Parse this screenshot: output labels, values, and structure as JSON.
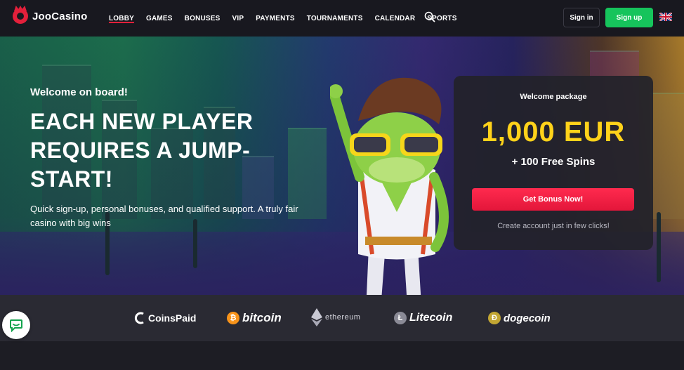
{
  "header": {
    "logo_text": "JooCasino",
    "nav": [
      {
        "label": "LOBBY",
        "active": true
      },
      {
        "label": "GAMES"
      },
      {
        "label": "BONUSES"
      },
      {
        "label": "VIP"
      },
      {
        "label": "PAYMENTS"
      },
      {
        "label": "TOURNAMENTS"
      },
      {
        "label": "CALENDAR"
      },
      {
        "label": "SPORTS"
      }
    ],
    "signin_label": "Sign in",
    "signup_label": "Sign up",
    "language_icon": "uk-flag-icon"
  },
  "hero": {
    "welcome": "Welcome on board!",
    "headline_line1": "EACH NEW PLAYER",
    "headline_line2": "REQUIRES A JUMP-",
    "headline_line3": "START!",
    "subtext": "Quick sign-up, personal bonuses, and qualified support. A truly fair casino with big wins"
  },
  "bonus": {
    "label": "Welcome package",
    "amount": "1,000 EUR",
    "spins": "+ 100 Free Spins",
    "button_label": "Get Bonus Now!",
    "note": "Create account just in few clicks!"
  },
  "payments": {
    "coinspaid": "CoinsPaid",
    "bitcoin": "bitcoin",
    "ethereum": "ethereum",
    "litecoin": "Litecoin",
    "dogecoin": "dogecoin"
  },
  "colors": {
    "accent_red": "#e3203b",
    "signup_green": "#16c45c",
    "bonus_yellow": "#ffd21a",
    "bitcoin_orange": "#f7931a",
    "dogecoin_gold": "#c2a633"
  }
}
